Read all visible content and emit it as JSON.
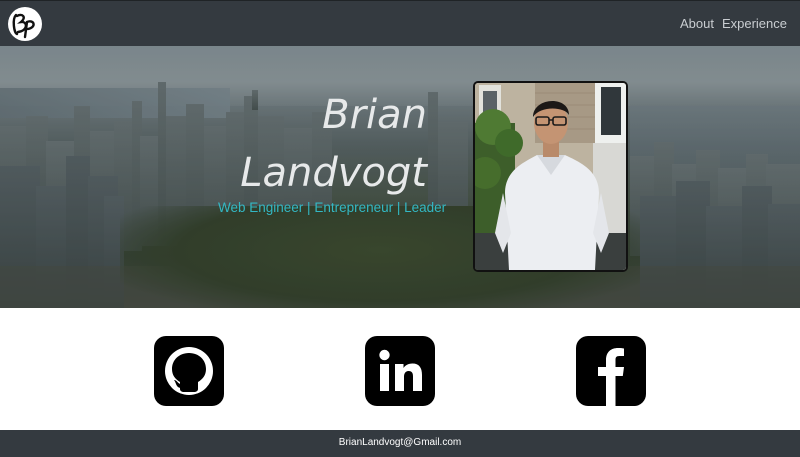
{
  "navbar": {
    "logo_text": "Bp",
    "links": [
      {
        "label": "About"
      },
      {
        "label": "Experience"
      }
    ]
  },
  "hero": {
    "name_first": "Brian",
    "name_last": "Landvogt",
    "tagline": "Web Engineer | Entrepreneur | Leader"
  },
  "social": [
    {
      "name": "GitHub",
      "icon": "github-icon"
    },
    {
      "name": "LinkedIn",
      "icon": "linkedin-icon"
    },
    {
      "name": "Facebook",
      "icon": "facebook-icon"
    }
  ],
  "footer": {
    "email": "BrianLandvogt@Gmail.com"
  },
  "colors": {
    "navbar_bg": "#343a40",
    "tagline": "#33b8c4",
    "nav_text": "#c9cdd1"
  }
}
